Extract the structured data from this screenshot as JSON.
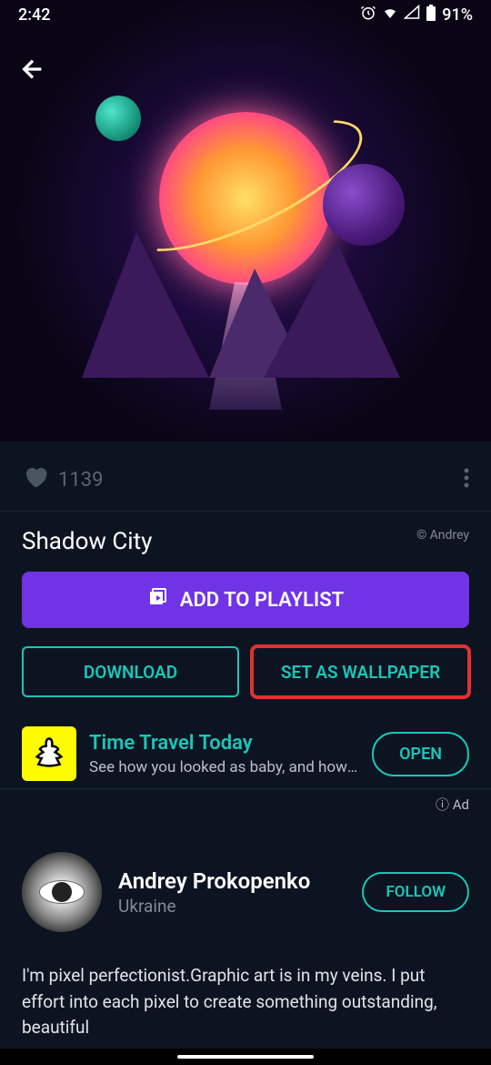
{
  "status": {
    "time": "2:42",
    "battery": "91%"
  },
  "likes_count": "1139",
  "title": "Shadow City",
  "copyright": "© Andrey",
  "buttons": {
    "add_to_playlist": "ADD TO PLAYLIST",
    "download": "DOWNLOAD",
    "set_wallpaper": "SET AS WALLPAPER"
  },
  "ad": {
    "title": "Time Travel Today",
    "subtitle": "See how you looked as baby, and how y…",
    "open": "OPEN",
    "label": "Ad"
  },
  "artist": {
    "name": "Andrey Prokopenko",
    "location": "Ukraine",
    "follow": "FOLLOW",
    "bio": "I'm pixel perfectionist.Graphic art is in my veins. I put effort into each pixel to create something outstanding, beautiful"
  }
}
